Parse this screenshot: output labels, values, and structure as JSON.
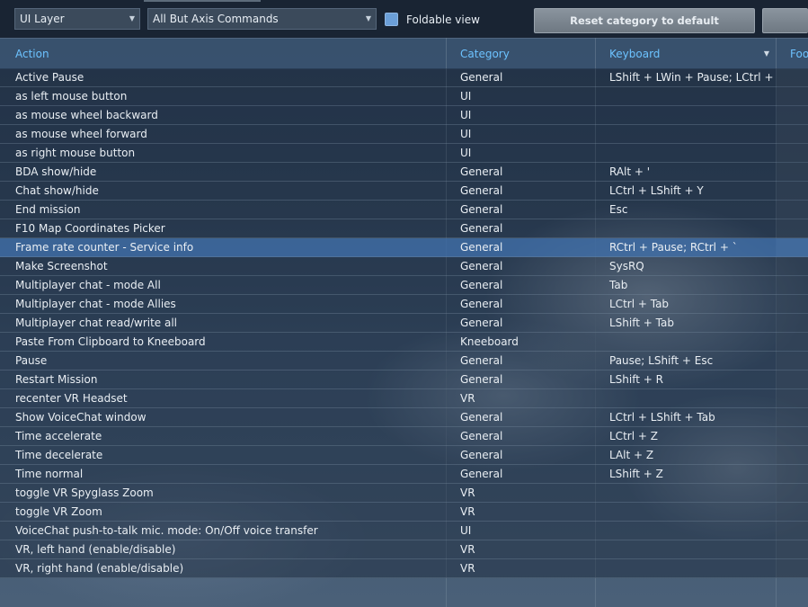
{
  "toolbar": {
    "layer_select": "UI Layer",
    "filter_select": "All But Axis Commands",
    "foldable_label": "Foldable view",
    "foldable_checked": true,
    "reset_button": "Reset category to default"
  },
  "table": {
    "columns": [
      "Action",
      "Category",
      "Keyboard",
      "Foo"
    ],
    "selected_row": 9,
    "rows": [
      {
        "action": "Active Pause",
        "category": "General",
        "keyboard": "LShift + LWin + Pause; LCtrl +"
      },
      {
        "action": "as left mouse button",
        "category": "UI",
        "keyboard": ""
      },
      {
        "action": "as mouse wheel backward",
        "category": "UI",
        "keyboard": ""
      },
      {
        "action": "as mouse wheel forward",
        "category": "UI",
        "keyboard": ""
      },
      {
        "action": "as right mouse button",
        "category": "UI",
        "keyboard": ""
      },
      {
        "action": "BDA show/hide",
        "category": "General",
        "keyboard": "RAlt + '"
      },
      {
        "action": "Chat show/hide",
        "category": "General",
        "keyboard": "LCtrl + LShift + Y"
      },
      {
        "action": "End mission",
        "category": "General",
        "keyboard": "Esc"
      },
      {
        "action": "F10 Map Coordinates Picker",
        "category": "General",
        "keyboard": ""
      },
      {
        "action": "Frame rate counter - Service info",
        "category": "General",
        "keyboard": "RCtrl + Pause; RCtrl + `"
      },
      {
        "action": "Make Screenshot",
        "category": "General",
        "keyboard": "SysRQ"
      },
      {
        "action": "Multiplayer chat - mode All",
        "category": "General",
        "keyboard": "Tab"
      },
      {
        "action": "Multiplayer chat - mode Allies",
        "category": "General",
        "keyboard": "LCtrl + Tab"
      },
      {
        "action": "Multiplayer chat read/write all",
        "category": "General",
        "keyboard": "LShift + Tab"
      },
      {
        "action": "Paste From Clipboard to Kneeboard",
        "category": "Kneeboard",
        "keyboard": ""
      },
      {
        "action": "Pause",
        "category": "General",
        "keyboard": "Pause; LShift + Esc"
      },
      {
        "action": "Restart Mission",
        "category": "General",
        "keyboard": "LShift + R"
      },
      {
        "action": "recenter VR Headset",
        "category": "VR",
        "keyboard": ""
      },
      {
        "action": "Show VoiceChat window",
        "category": "General",
        "keyboard": "LCtrl + LShift + Tab"
      },
      {
        "action": "Time accelerate",
        "category": "General",
        "keyboard": "LCtrl + Z"
      },
      {
        "action": "Time decelerate",
        "category": "General",
        "keyboard": "LAlt + Z"
      },
      {
        "action": "Time normal",
        "category": "General",
        "keyboard": "LShift + Z"
      },
      {
        "action": "toggle VR Spyglass Zoom",
        "category": "VR",
        "keyboard": ""
      },
      {
        "action": "toggle VR Zoom",
        "category": "VR",
        "keyboard": ""
      },
      {
        "action": "VoiceChat push-to-talk mic. mode: On/Off voice transfer",
        "category": "UI",
        "keyboard": ""
      },
      {
        "action": "VR, left hand (enable/disable)",
        "category": "VR",
        "keyboard": ""
      },
      {
        "action": "VR, right hand (enable/disable)",
        "category": "VR",
        "keyboard": ""
      }
    ]
  },
  "colors": {
    "header_text": "#6cc2ff",
    "selected_row": "#3c69a0",
    "checkbox": "#6b9fd8"
  },
  "icons": {
    "dropdown": "chevron-down-icon",
    "sort": "sort-down-icon"
  }
}
